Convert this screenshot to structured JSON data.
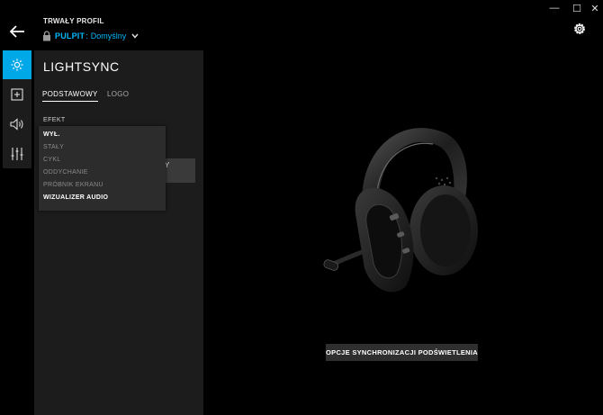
{
  "window": {
    "minimize_glyph": "—",
    "maximize_glyph": "☐",
    "close_glyph": "✕"
  },
  "header": {
    "profile_label": "TRWAŁY PROFIL",
    "desktop_label": "PULPIT",
    "separator": ":",
    "profile_name": "Domyślny",
    "icons": [
      "back-arrow-icon",
      "lock-icon",
      "chevron-down-icon",
      "gear-icon"
    ]
  },
  "rail": {
    "items": [
      {
        "icon": "lightsync-icon",
        "active": true
      },
      {
        "icon": "add-icon",
        "active": false
      },
      {
        "icon": "sound-icon",
        "active": false
      },
      {
        "icon": "equalizer-icon",
        "active": false
      }
    ]
  },
  "panel": {
    "title": "LIGHTSYNC",
    "tabs": [
      {
        "label": "PODSTAWOWY",
        "active": true
      },
      {
        "label": "LOGO",
        "active": false
      }
    ],
    "effect_label": "EFEKT",
    "behind_text": "Y",
    "dropdown": {
      "options": [
        "WYŁ.",
        "STAŁY",
        "CYKL",
        "ODDYCHANIE",
        "PRÓBNIK EKRANU",
        "WIZUALIZER AUDIO"
      ]
    }
  },
  "main": {
    "sync_button": "OPCJE SYNCHRONIZACJI PODŚWIETLENIA"
  },
  "colors": {
    "accent": "#00b8fc",
    "rail_active": "#00a8e8",
    "panel_bg": "#1c1c1c",
    "background": "#000000"
  }
}
